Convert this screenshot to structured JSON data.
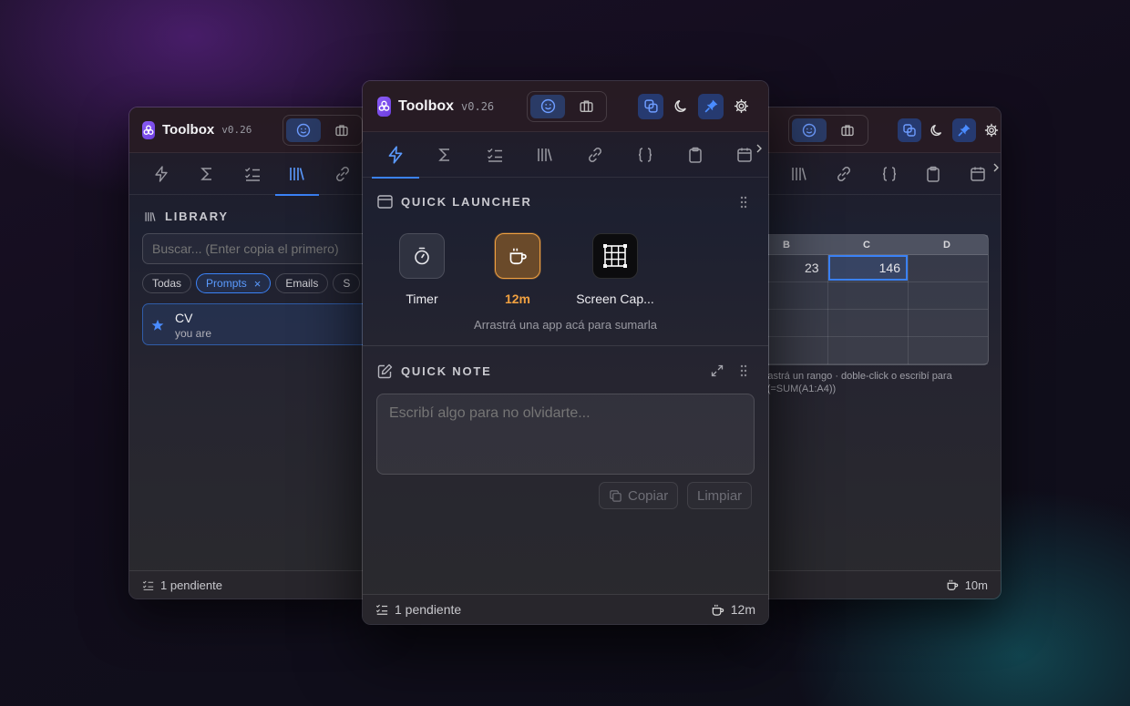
{
  "app": {
    "name": "Toolbox",
    "version": "v0.26"
  },
  "left_window": {
    "section_title": "LIBRARY",
    "search": {
      "placeholder": "Buscar... (Enter copia el primero)"
    },
    "filters": [
      {
        "label": "Todas"
      },
      {
        "label": "Prompts",
        "selected": true,
        "close": "×"
      },
      {
        "label": "Emails"
      },
      {
        "label": "S"
      }
    ],
    "items": [
      {
        "title": "CV",
        "subtitle": "you are",
        "starred": true
      }
    ],
    "footer": {
      "pending": "1 pendiente"
    }
  },
  "right_window": {
    "columns": [
      "B",
      "C",
      "D"
    ],
    "cells": {
      "b1": "23",
      "c1": "146"
    },
    "hint_line1": "rrastrá un rango · doble-click o escribí para",
    "hint_line2": "› (=SUM(A1:A4))",
    "footer": {
      "timer": "10m"
    }
  },
  "main_window": {
    "tabs": [
      "lightning-icon",
      "sigma-icon",
      "checklist-icon",
      "library-icon",
      "link-icon",
      "braces-icon",
      "clipboard-icon",
      "calendar-icon"
    ],
    "quick_launcher": {
      "title": "QUICK LAUNCHER",
      "apps": [
        {
          "label": "Timer",
          "icon": "stopwatch-icon"
        },
        {
          "label": "12m",
          "icon": "coffee-icon",
          "active": true
        },
        {
          "label": "Screen Cap...",
          "icon": "grid-capture-icon"
        }
      ],
      "hint": "Arrastrá una app acá para sumarla"
    },
    "quick_note": {
      "title": "QUICK NOTE",
      "placeholder": "Escribí algo para no olvidarte...",
      "copy_label": "Copiar",
      "clear_label": "Limpiar"
    },
    "footer": {
      "pending": "1 pendiente",
      "timer": "12m"
    }
  },
  "colors": {
    "accent": "#3b82f6",
    "timer_orange": "#f0a040"
  }
}
